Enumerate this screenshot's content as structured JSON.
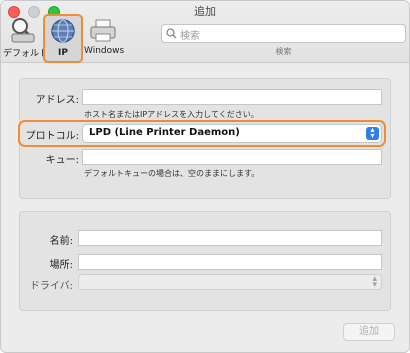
{
  "window": {
    "title": "追加"
  },
  "toolbar": {
    "default_label": "デフォルト",
    "ip_label": "IP",
    "windows_label": "Windows",
    "search_placeholder": "検索",
    "search_caption": "検索"
  },
  "form": {
    "address_label": "アドレス:",
    "address_value": "",
    "address_hint": "ホスト名またはIPアドレスを入力してください。",
    "protocol_label": "プロトコル:",
    "protocol_value": "LPD (Line Printer Daemon)",
    "queue_label": "キュー:",
    "queue_value": "",
    "queue_hint": "デフォルトキューの場合は、空のままにします。",
    "name_label": "名前:",
    "name_value": "",
    "location_label": "場所:",
    "location_value": "",
    "driver_label": "ドライバ:",
    "driver_value": ""
  },
  "actions": {
    "add_label": "追加"
  },
  "colors": {
    "highlight": "#f08c32",
    "stepper": "#2f7ff0"
  }
}
